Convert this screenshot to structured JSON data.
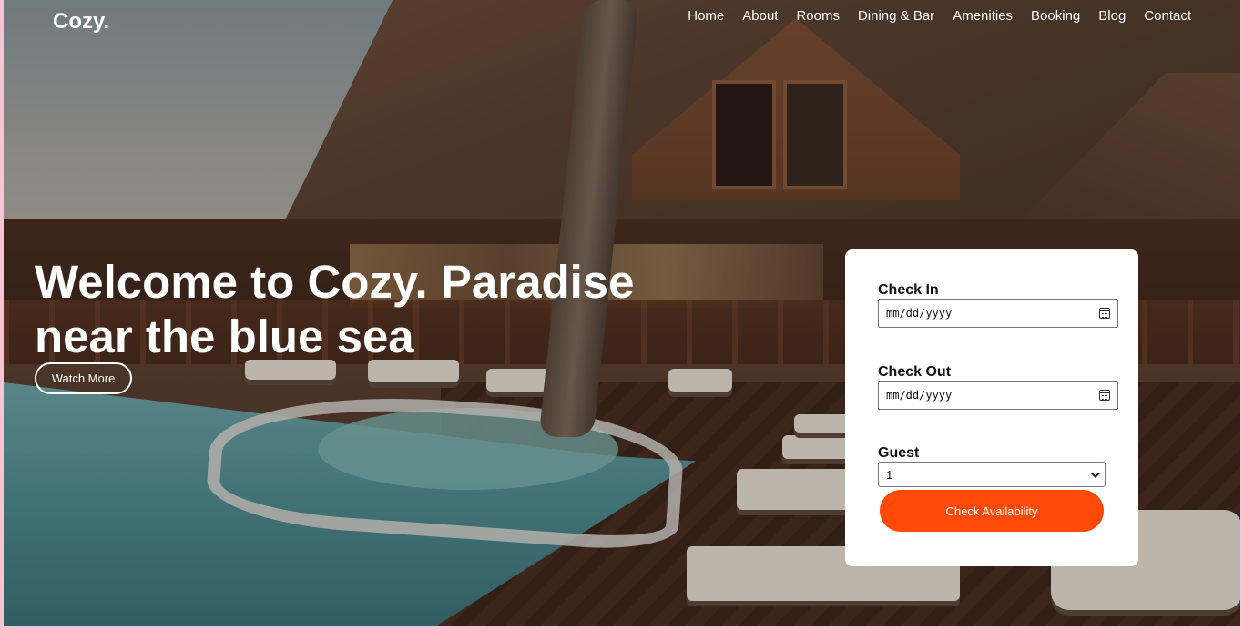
{
  "brand": {
    "logo": "Cozy."
  },
  "nav": {
    "items": [
      "Home",
      "About",
      "Rooms",
      "Dining & Bar",
      "Amenities",
      "Booking",
      "Blog",
      "Contact"
    ]
  },
  "hero": {
    "headline": "Welcome to Cozy. Paradise near the blue sea",
    "watch_more": "Watch More"
  },
  "booking": {
    "check_in_label": "Check In",
    "check_in_value": "mm/dd/yyyy",
    "check_out_label": "Check Out",
    "check_out_value": "mm/dd/yyyy",
    "guest_label": "Guest",
    "guest_value": "1",
    "submit_label": "Check Availability"
  },
  "colors": {
    "accent": "#ff4a0a",
    "page_border": "#f7c4d4"
  }
}
